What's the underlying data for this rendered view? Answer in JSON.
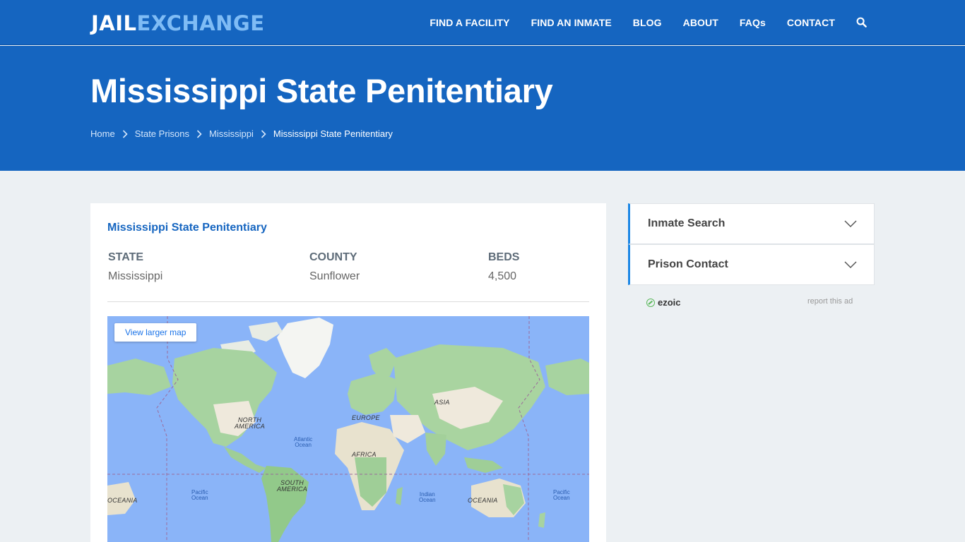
{
  "logo": {
    "part1": "JAIL",
    "part2": "EXCHANGE"
  },
  "nav": {
    "items": [
      "FIND A FACILITY",
      "FIND AN INMATE",
      "BLOG",
      "ABOUT",
      "FAQs",
      "CONTACT"
    ],
    "search_icon": "search-icon"
  },
  "hero": {
    "title": "Mississippi State Penitentiary",
    "breadcrumbs": [
      "Home",
      "State Prisons",
      "Mississippi",
      "Mississippi State Penitentiary"
    ]
  },
  "facility": {
    "name": "Mississippi State Penitentiary",
    "state_label": "STATE",
    "state_value": "Mississippi",
    "county_label": "COUNTY",
    "county_value": "Sunflower",
    "beds_label": "BEDS",
    "beds_value": "4,500"
  },
  "map": {
    "button_label": "View larger map",
    "labels": {
      "north_america_1": "NORTH",
      "north_america_2": "AMERICA",
      "south_america_1": "SOUTH",
      "south_america_2": "AMERICA",
      "europe": "EUROPE",
      "asia": "ASIA",
      "africa": "AFRICA",
      "oceania": "OCEANIA",
      "oceania_left": "OCEANIA",
      "atlantic_1": "Atlantic",
      "atlantic_2": "Ocean",
      "pacific_1": "Pacific",
      "pacific_2": "Ocean",
      "pacific_right_1": "Pacific",
      "pacific_right_2": "Ocean",
      "indian_1": "Indian",
      "indian_2": "Ocean"
    }
  },
  "sidebar": {
    "accordion": [
      "Inmate Search",
      "Prison Contact"
    ],
    "ad_brand": "ezoic",
    "report_ad": "report this ad"
  },
  "colors": {
    "brand": "#1565c0",
    "accent": "#1e88e5",
    "logo_accent": "#7fbcf5"
  }
}
